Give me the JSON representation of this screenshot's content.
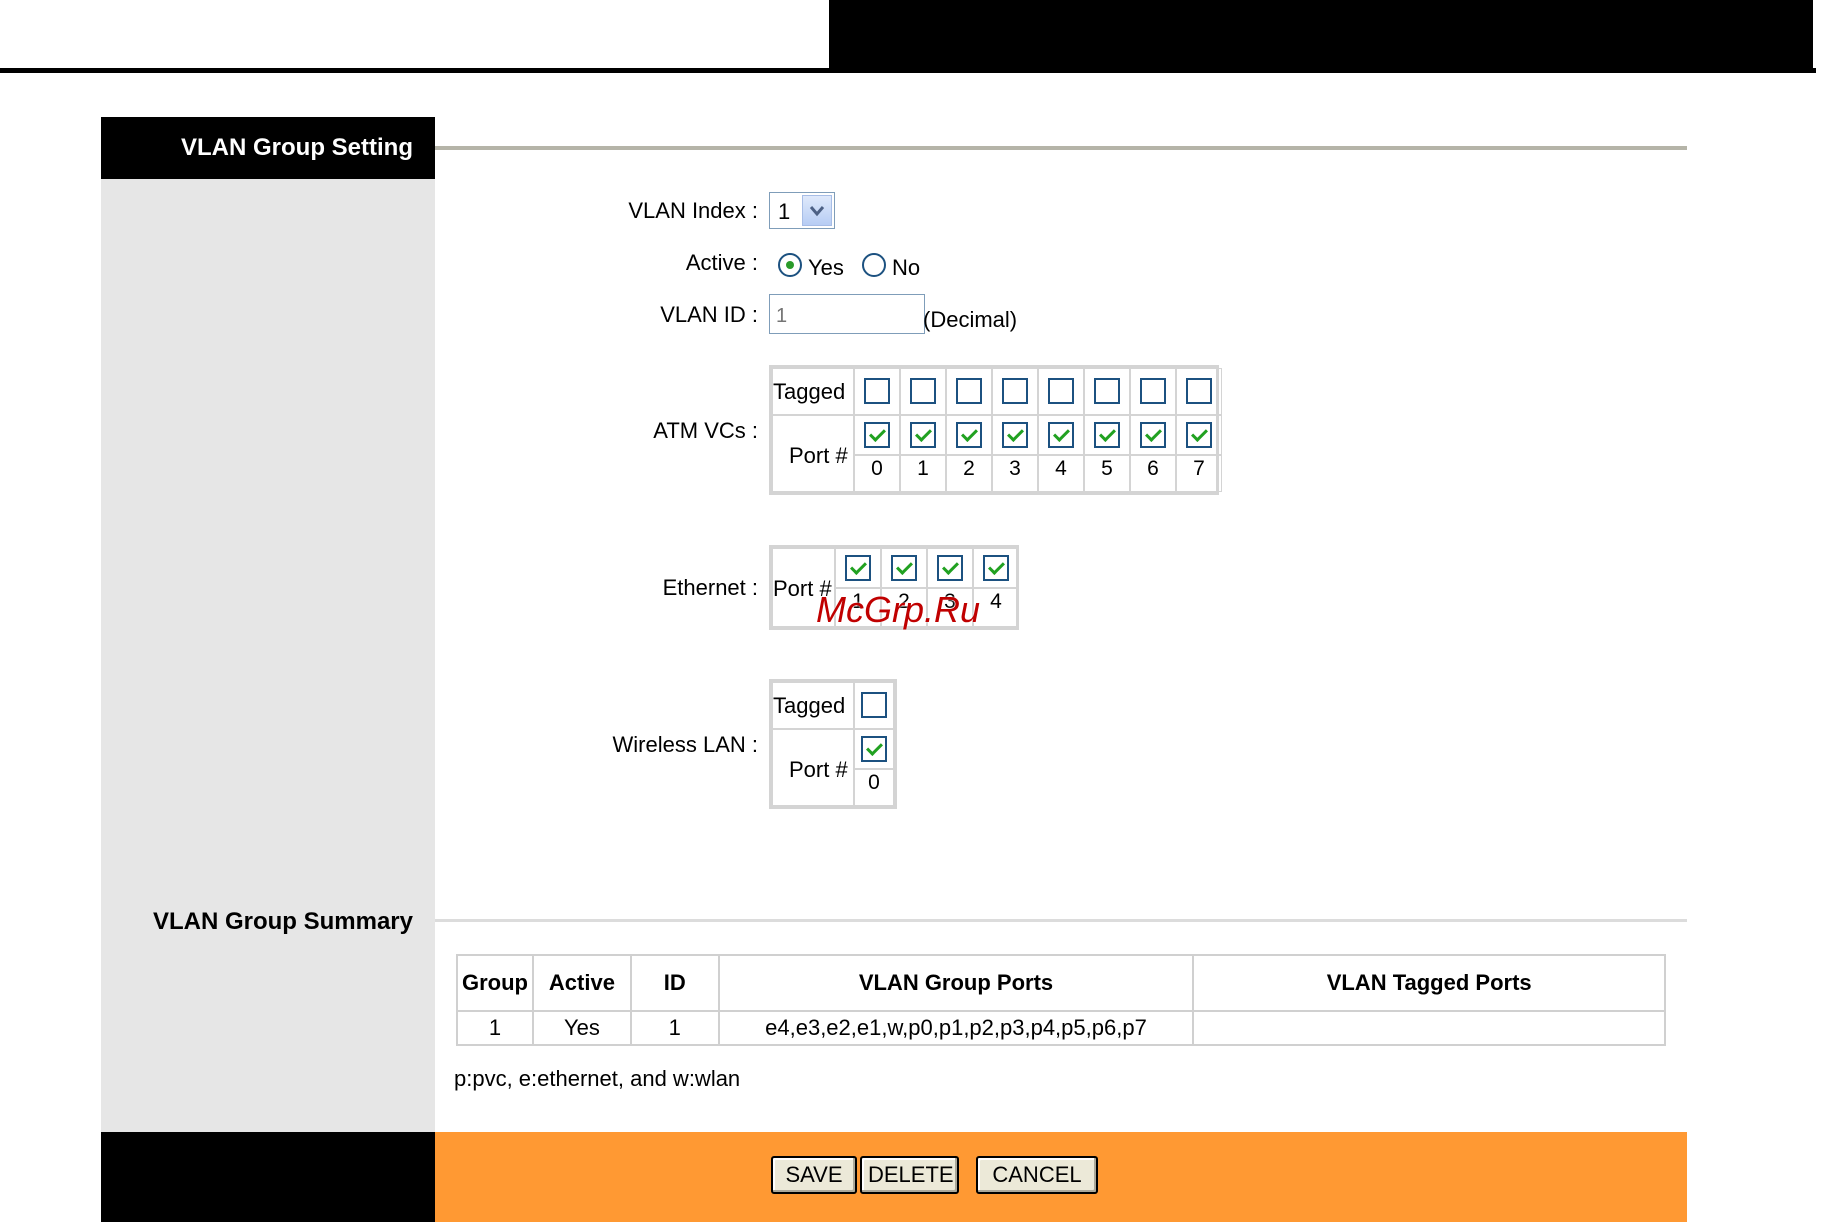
{
  "group_setting": {
    "title": "VLAN Group Setting",
    "vlan_index": {
      "label": "VLAN Index :",
      "value": "1"
    },
    "active": {
      "label": "Active :",
      "yes_label": "Yes",
      "no_label": "No",
      "selected": "Yes"
    },
    "vlan_id": {
      "label": "VLAN ID :",
      "placeholder": "1",
      "suffix": "(Decimal)"
    },
    "atm_vcs": {
      "label": "ATM VCs :",
      "tagged_label": "Tagged",
      "port_label": "Port #",
      "ports": [
        "0",
        "1",
        "2",
        "3",
        "4",
        "5",
        "6",
        "7"
      ],
      "tagged": [
        false,
        false,
        false,
        false,
        false,
        false,
        false,
        false
      ],
      "member": [
        true,
        true,
        true,
        true,
        true,
        true,
        true,
        true
      ]
    },
    "ethernet": {
      "label": "Ethernet :",
      "port_label": "Port #",
      "ports": [
        "1",
        "2",
        "3",
        "4"
      ],
      "member": [
        true,
        true,
        true,
        true
      ]
    },
    "wireless_lan": {
      "label": "Wireless LAN :",
      "tagged_label": "Tagged",
      "port_label": "Port #",
      "ports": [
        "0"
      ],
      "tagged": [
        false
      ],
      "member": [
        true
      ]
    }
  },
  "group_summary": {
    "title": "VLAN Group Summary",
    "columns": [
      "Group",
      "Active",
      "ID",
      "VLAN Group Ports",
      "VLAN Tagged Ports"
    ],
    "rows": [
      [
        "1",
        "Yes",
        "1",
        "e4,e3,e2,e1,w,p0,p1,p2,p3,p4,p5,p6,p7",
        ""
      ]
    ],
    "legend": "p:pvc, e:ethernet, and w:wlan"
  },
  "buttons": {
    "save": "SAVE",
    "delete": "DELETE",
    "cancel": "CANCEL"
  },
  "watermark": "McGrp.Ru",
  "colors": {
    "accent_bar": "#ff9933",
    "header_bg": "#000000",
    "left_column": "#e6e6e6"
  }
}
